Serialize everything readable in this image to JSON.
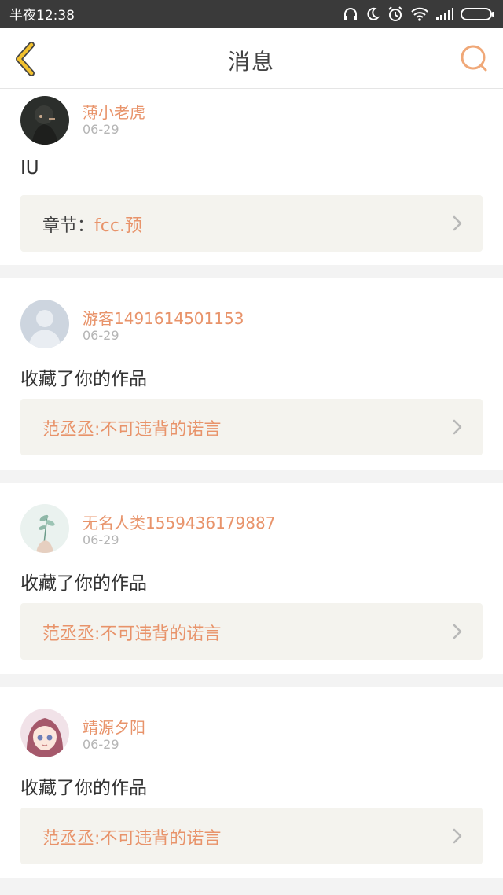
{
  "status_bar": {
    "time": "半夜12:38"
  },
  "nav": {
    "title": "消息"
  },
  "colors": {
    "accent": "#e8936a",
    "back_icon": "#f2c12e",
    "link_bg": "#f4f3ee"
  },
  "icons": {
    "back": "chevron-left-icon",
    "search": "search-icon",
    "arrow": "chevron-right-icon"
  },
  "messages": [
    {
      "username": "薄小老虎",
      "date": "06-29",
      "content": "IU",
      "link_prefix": "章节：",
      "link_title": "fcc.预"
    },
    {
      "username": "游客1491614501153",
      "date": "06-29",
      "content": "收藏了你的作品",
      "link_prefix": "",
      "link_title": "范丞丞:不可违背的诺言"
    },
    {
      "username": "无名人类1559436179887",
      "date": "06-29",
      "content": "收藏了你的作品",
      "link_prefix": "",
      "link_title": "范丞丞:不可违背的诺言"
    },
    {
      "username": "靖源夕阳",
      "date": "06-29",
      "content": "收藏了你的作品",
      "link_prefix": "",
      "link_title": "范丞丞:不可违背的诺言"
    }
  ]
}
